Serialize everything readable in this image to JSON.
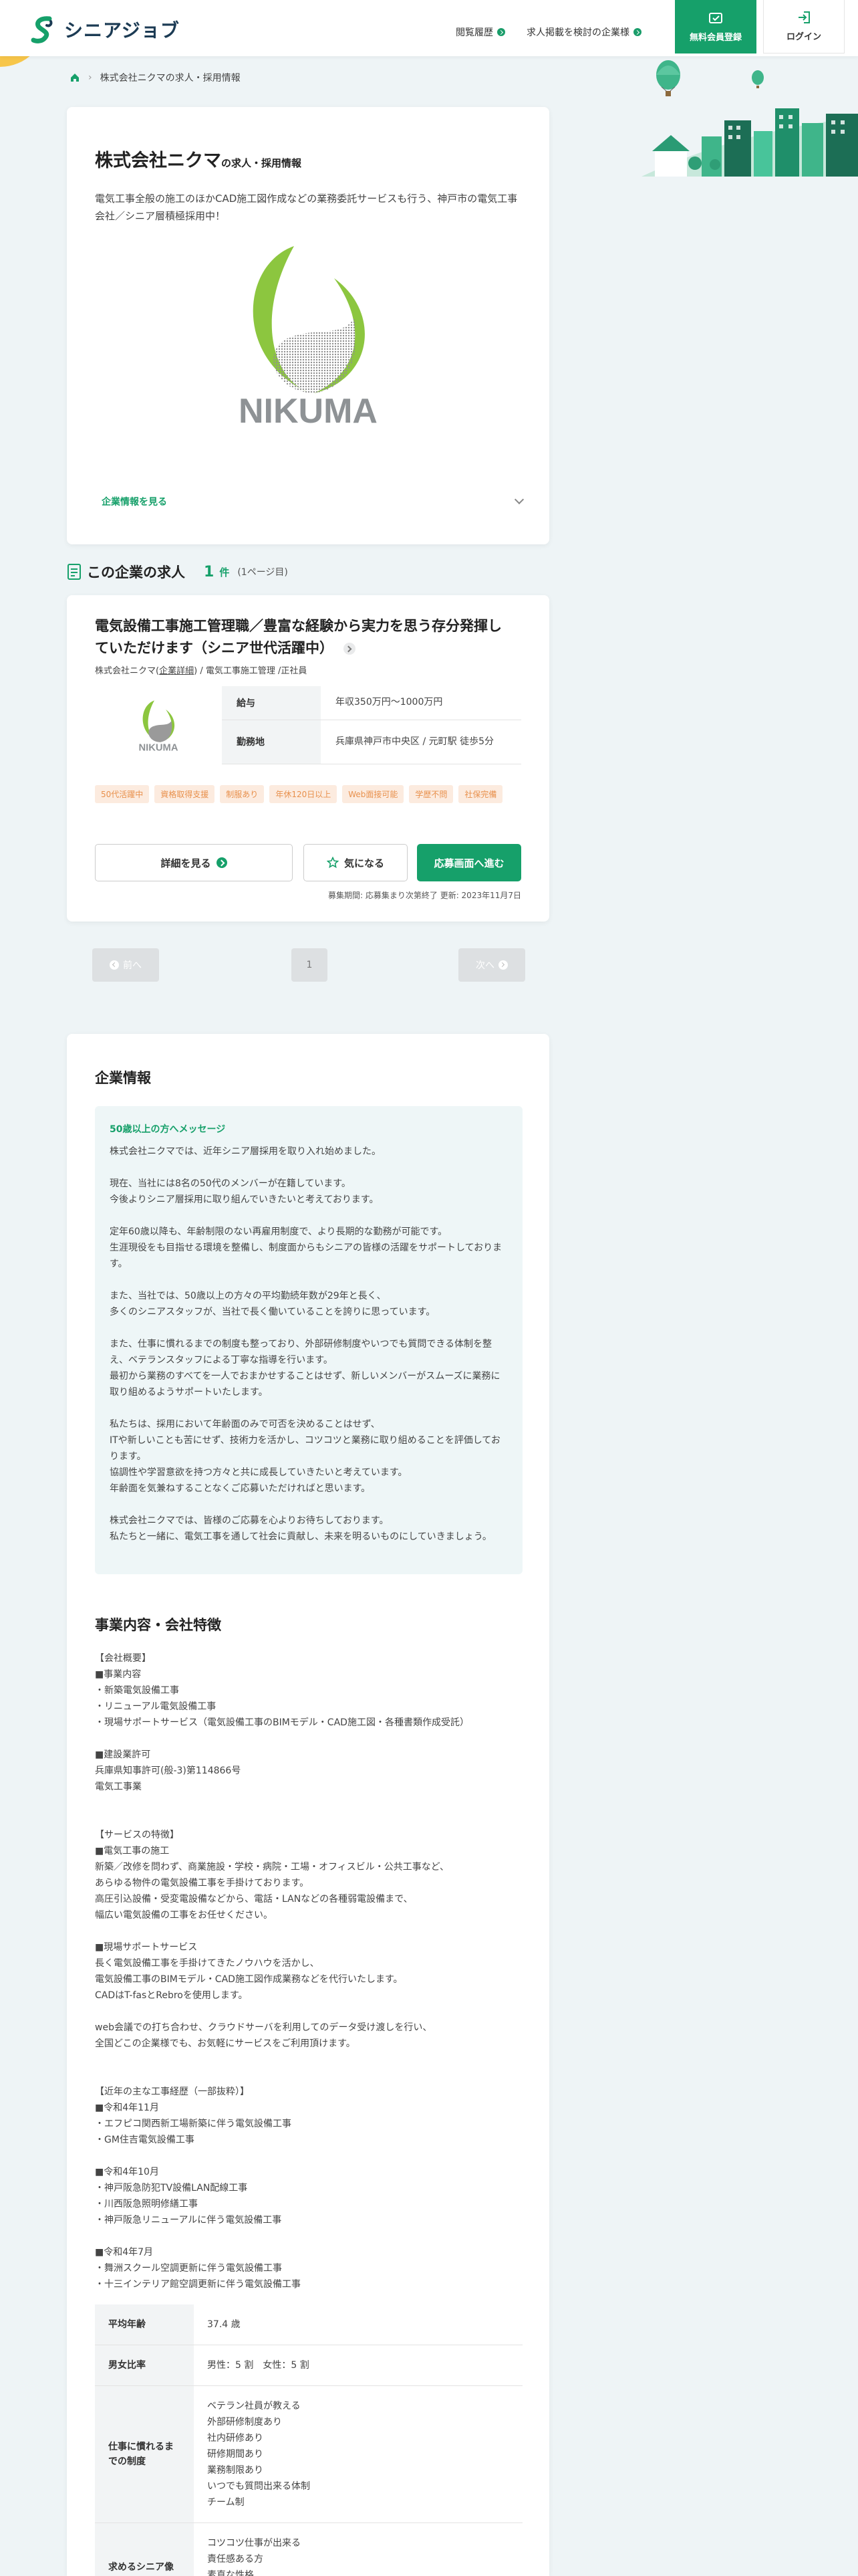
{
  "header": {
    "logo_text": "シニアジョブ",
    "history_label": "閲覧履歴",
    "consider_label": "求人掲載を検討の企業様",
    "register_label": "無料会員登録",
    "login_label": "ログイン"
  },
  "breadcrumb": {
    "current": "株式会社ニクマの求人・採用情報"
  },
  "company": {
    "name": "株式会社ニクマ",
    "name_suffix": "の求人・採用情報",
    "description": "電気工事全般の施工のほかCAD施工図作成などの業務委託サービスも行う、神戸市の電気工事会社／シニア層積極採用中！",
    "logo_text": "NIKUMA",
    "more_label": "企業情報を見る"
  },
  "jobs_section": {
    "title": "この企業の求人",
    "count": "1",
    "count_unit": "件",
    "page_info": "(1ページ目)"
  },
  "job": {
    "title": "電気設備工事施工管理職／豊富な経験から実力を思う存分発揮していただけます（シニア世代活躍中）",
    "company": "株式会社ニクマ",
    "company_detail_link": "企業詳細",
    "category": "電気工事施工管理",
    "employment": "正社員",
    "salary_label": "給与",
    "salary_value": "年収350万円〜1000万円",
    "location_label": "勤務地",
    "location_value": "兵庫県神戸市中央区 / 元町駅 徒歩5分",
    "tags": [
      "50代活躍中",
      "資格取得支援",
      "制服あり",
      "年休120日以上",
      "Web面接可能",
      "学歴不問",
      "社保完備"
    ],
    "detail_button": "詳細を見る",
    "favorite_button": "気になる",
    "apply_button": "応募画面へ進む",
    "meta": "募集期間: 応募集まり次第終了  更新: 2023年11月7日"
  },
  "pagination": {
    "prev": "前へ",
    "current": "1",
    "next": "次へ"
  },
  "company_info": {
    "title": "企業情報",
    "message_title": "50歳以上の方へメッセージ",
    "message_body": "株式会社ニクマでは、近年シニア層採用を取り入れ始めました。\n\n現在、当社には8名の50代のメンバーが在籍しています。\n今後よりシニア層採用に取り組んでいきたいと考えております。\n\n定年60歳以降も、年齢制限のない再雇用制度で、より長期的な勤務が可能です。\n生涯現役をも目指せる環境を整備し、制度面からもシニアの皆様の活躍をサポートしております。\n\nまた、当社では、50歳以上の方々の平均勤続年数が29年と長く、\n多くのシニアスタッフが、当社で長く働いていることを誇りに思っています。\n\nまた、仕事に慣れるまでの制度も整っており、外部研修制度やいつでも質問できる体制を整え、ベテランスタッフによる丁寧な指導を行います。\n最初から業務のすべてを一人でおまかせすることはせず、新しいメンバーがスムーズに業務に取り組めるようサポートいたします。\n\n私たちは、採用において年齢面のみで可否を決めることはせず、\nITや新しいことも苦にせず、技術力を活かし、コツコツと業務に取り組めることを評価しております。\n協調性や学習意欲を持つ方々と共に成長していきたいと考えています。\n年齢面を気兼ねすることなくご応募いただければと思います。\n\n株式会社ニクマでは、皆様のご応募を心よりお待ちしております。\n私たちと一緒に、電気工事を通して社会に貢献し、未来を明るいものにしていきましょう。",
    "business_title": "事業内容・会社特徴",
    "business_body": "【会社概要】\n■事業内容\n・新築電気設備工事\n・リニューアル電気設備工事\n・現場サポートサービス（電気設備工事のBIMモデル・CAD施工図・各種書類作成受託）\n\n■建設業許可\n兵庫県知事許可(般-3)第114866号\n電気工事業\n\n\n【サービスの特徴】\n■電気工事の施工\n新築／改修を問わず、商業施設・学校・病院・工場・オフィスビル・公共工事など、\nあらゆる物件の電気設備工事を手掛けております。\n高圧引込設備・受変電設備などから、電話・LANなどの各種弱電設備まで、\n幅広い電気設備の工事をお任せください。\n\n■現場サポートサービス\n長く電気設備工事を手掛けてきたノウハウを活かし、\n電気設備工事のBIMモデル・CAD施工図作成業務などを代行いたします。\nCADはT-fasとRebroを使用します。\n\nweb会議での打ち合わせ、クラウドサーバを利用してのデータ受け渡しを行い、\n全国どこの企業様でも、お気軽にサービスをご利用頂けます。\n\n\n【近年の主な工事経歴（一部抜粋）】\n■令和4年11月\n・エフピコ関西新工場新築に伴う電気設備工事\n・GM住吉電気設備工事\n\n■令和4年10月\n・神戸阪急防犯TV設備LAN配線工事\n・川西阪急照明修繕工事\n・神戸阪急リニューアルに伴う電気設備工事\n\n■令和4年7月\n・舞洲スクール空調更新に伴う電気設備工事\n・十三インテリア館空調更新に伴う電気設備工事",
    "table": [
      {
        "label": "平均年齢",
        "value": "37.4 歳"
      },
      {
        "label": "男女比率",
        "value": "男性：5 割　女性：5 割"
      },
      {
        "label": "仕事に慣れるまでの制度",
        "value": "ベテラン社員が教える\n外部研修制度あり\n社内研修あり\n研修期間あり\n業務制限あり\nいつでも質問出来る体制\nチーム制"
      },
      {
        "label": "求めるシニア像",
        "value": "コツコツ仕事が出来る\n責任感ある方\n素直な性格\nガッツがある"
      }
    ]
  },
  "colors": {
    "accent": "#16a06a",
    "tag_text": "#e8904c",
    "tag_bg": "#fcebdf",
    "logo_green": "#8cc63f"
  }
}
